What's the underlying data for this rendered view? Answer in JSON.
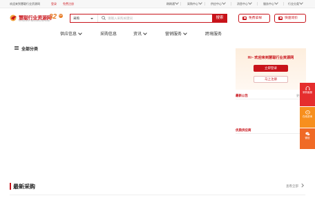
{
  "topbar": {
    "welcome": "欢迎来到慧聪行业资源网",
    "login": "登录",
    "register": "免费注册",
    "links": [
      "刷刷通",
      "采购中心",
      "供应中心",
      "消息中心",
      "服务中心",
      "行业分类"
    ]
  },
  "logo": {
    "name": "慧聪行业资源网",
    "sub": "HC INDUSTRY RESOURCE NETWORK",
    "badge": "32",
    "badge_sup": "周年"
  },
  "search": {
    "category": "采购",
    "placeholder": "请输入采购关键词",
    "value": "",
    "button": "搜索"
  },
  "header_buttons": {
    "sample": "免费拿样",
    "inquiry": "快速询价"
  },
  "nav": [
    {
      "label": "供应信息",
      "dropdown": true
    },
    {
      "label": "采购信息",
      "dropdown": false
    },
    {
      "label": "资讯",
      "dropdown": true
    },
    {
      "label": "营销服务",
      "dropdown": true
    },
    {
      "label": "跨境服务",
      "dropdown": false
    }
  ],
  "sidebar_title": "全部分类",
  "welcome_box": {
    "title": "Hi~ 欢迎来到慧聪行业资源网",
    "login": "立即登录",
    "register": "马上注册"
  },
  "notices": {
    "title": "最新公告",
    "more": "更多"
  },
  "suppliers": {
    "title": "优质供应商"
  },
  "float_bar": {
    "items": [
      "采购客服",
      "在线咨询",
      "微信"
    ],
    "colors": [
      "#e52d2d",
      "#f78f1e",
      "#f06a25"
    ]
  },
  "latest_purchase": {
    "title": "最新采购",
    "view_all": "查看全部"
  },
  "colors": {
    "brand": "#c8131a",
    "accent": "#e6781f"
  }
}
